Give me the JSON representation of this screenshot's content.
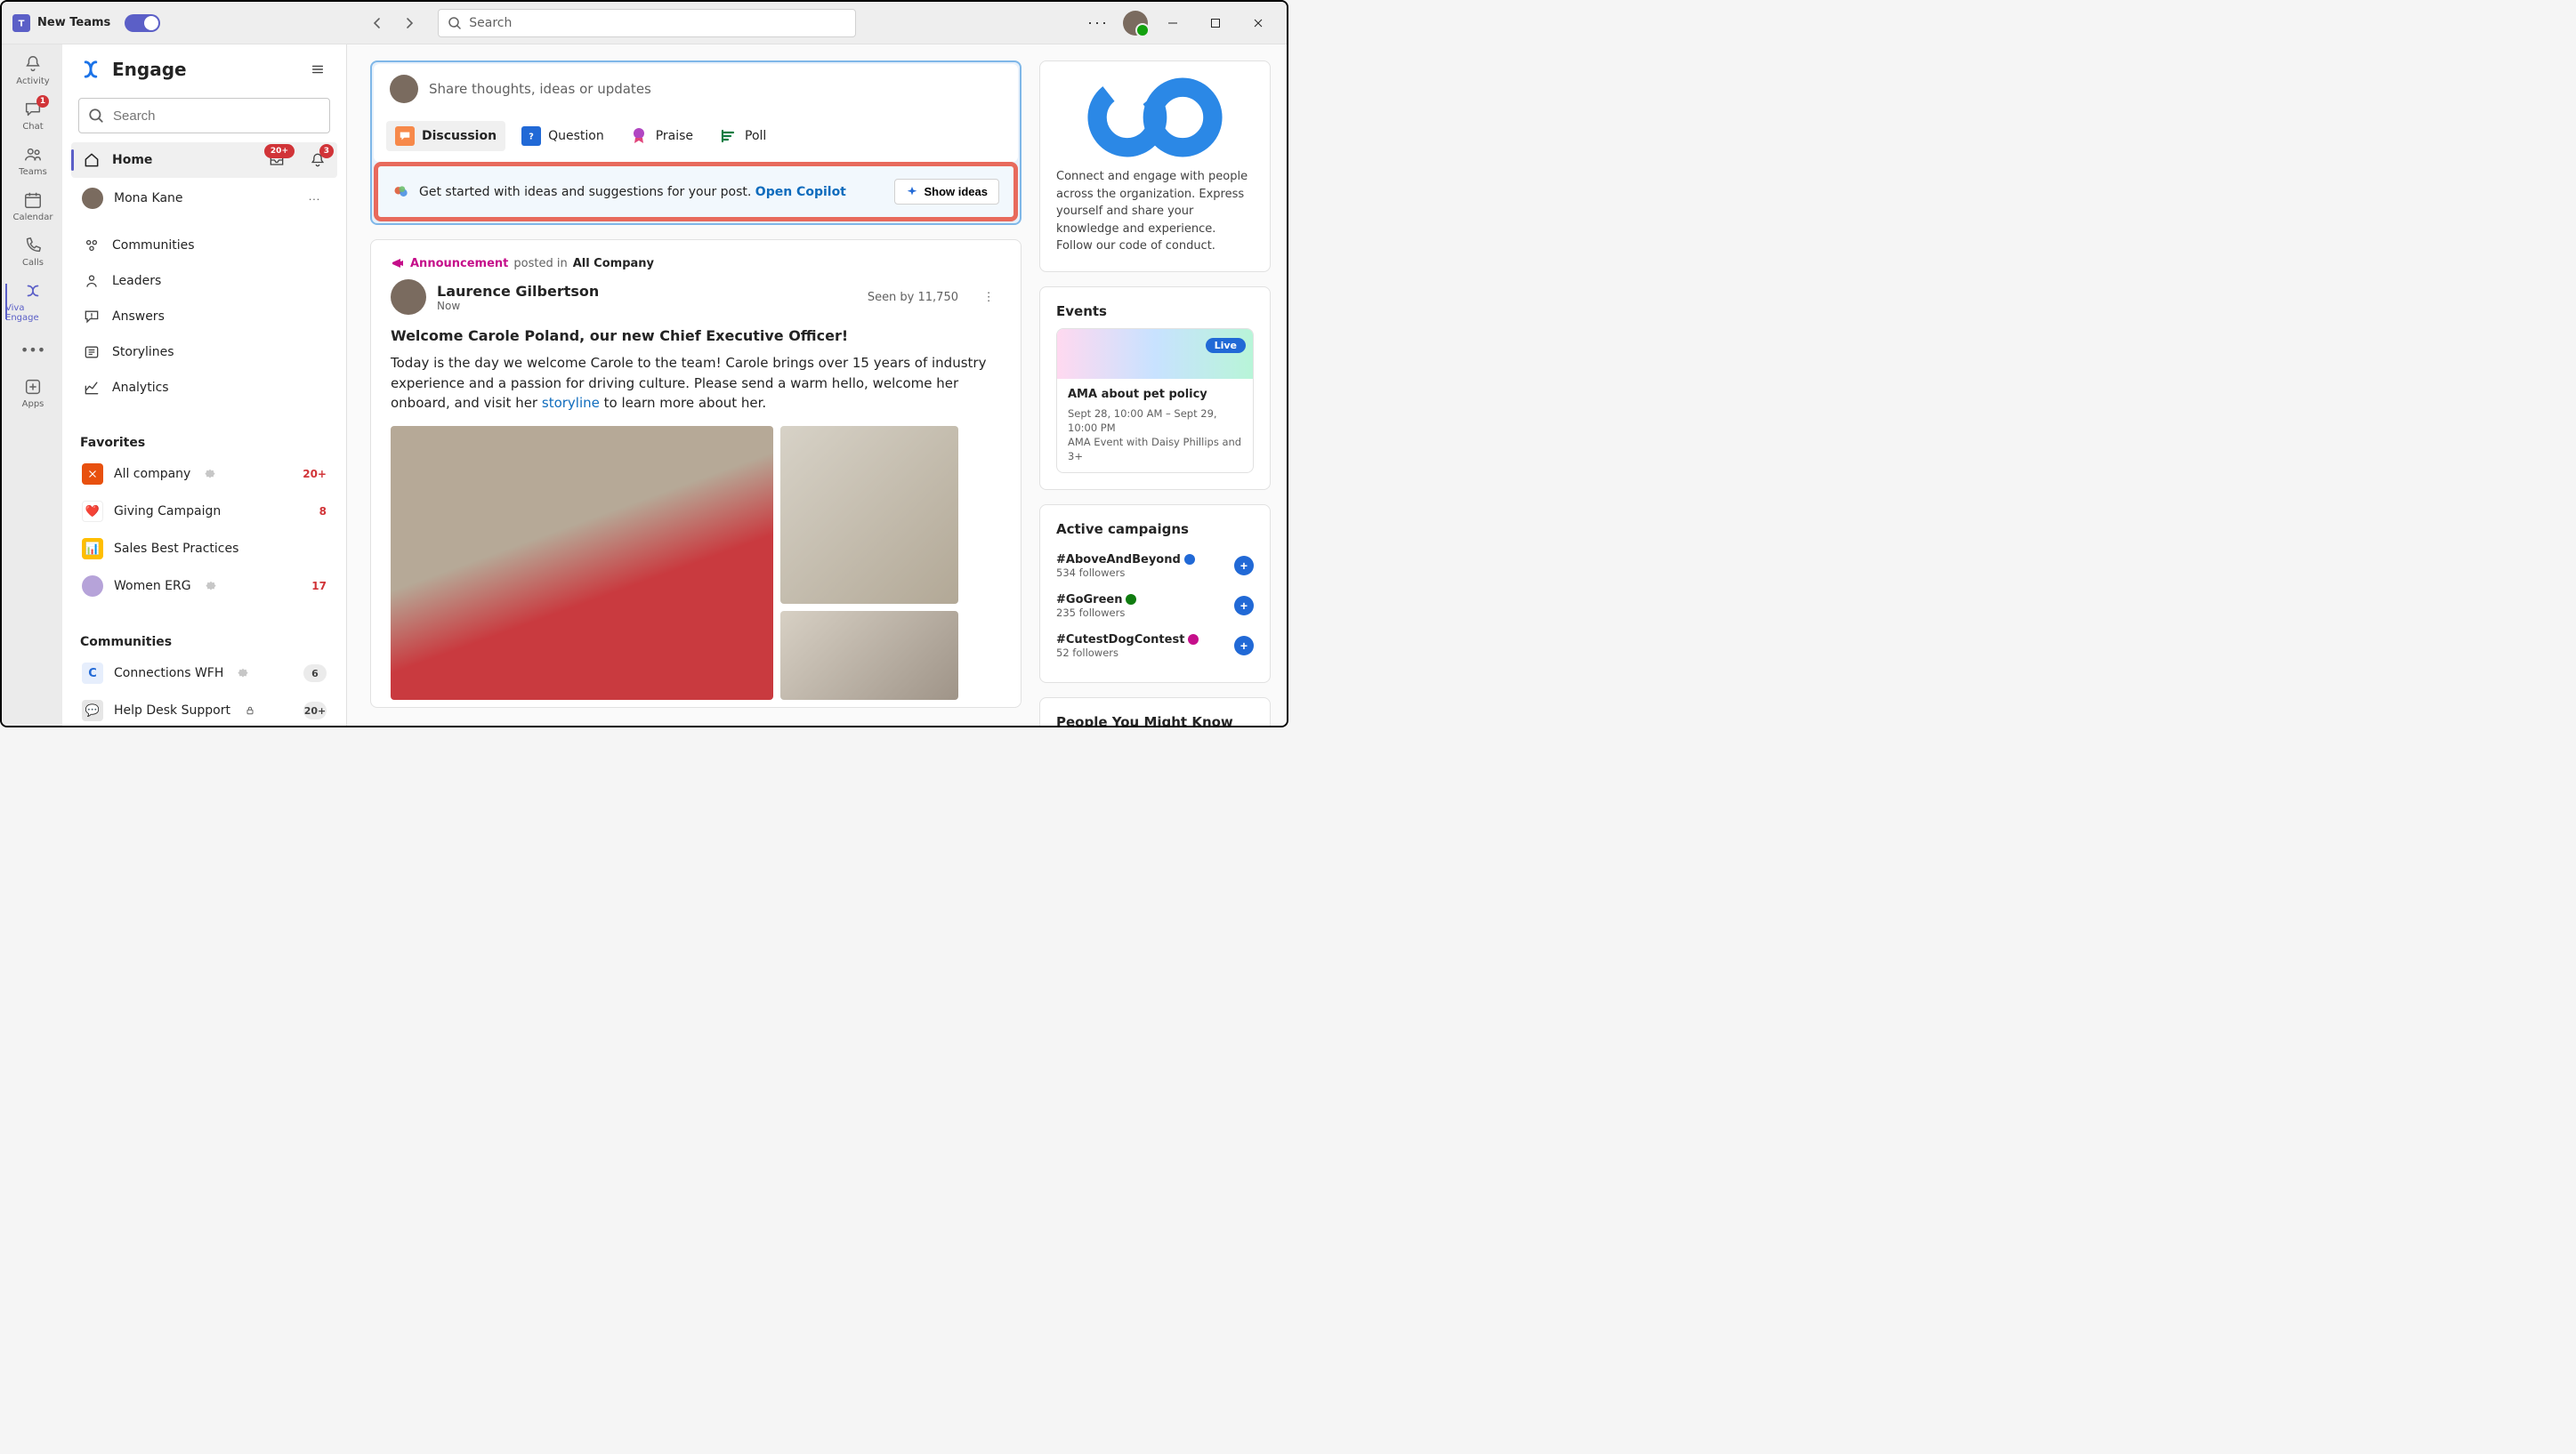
{
  "titlebar": {
    "app_name": "New Teams",
    "search_placeholder": "Search"
  },
  "rail": {
    "items": [
      {
        "id": "activity",
        "label": "Activity"
      },
      {
        "id": "chat",
        "label": "Chat",
        "badge": "1"
      },
      {
        "id": "teams",
        "label": "Teams"
      },
      {
        "id": "calendar",
        "label": "Calendar"
      },
      {
        "id": "calls",
        "label": "Calls"
      },
      {
        "id": "engage",
        "label": "Viva Engage",
        "active": true
      },
      {
        "id": "more",
        "label": ""
      },
      {
        "id": "apps",
        "label": "Apps"
      }
    ]
  },
  "side": {
    "title": "Engage",
    "search_placeholder": "Search",
    "nav": [
      {
        "id": "home",
        "label": "Home",
        "home_badge": "20+",
        "bell_badge": "3",
        "active": true
      },
      {
        "id": "mona",
        "label": "Mona Kane",
        "avatar": true
      },
      {
        "id": "communities",
        "label": "Communities"
      },
      {
        "id": "leaders",
        "label": "Leaders"
      },
      {
        "id": "answers",
        "label": "Answers"
      },
      {
        "id": "storylines",
        "label": "Storylines"
      },
      {
        "id": "analytics",
        "label": "Analytics"
      }
    ],
    "favorites_header": "Favorites",
    "favorites": [
      {
        "label": "All company",
        "count": "20+",
        "color": "#e8500e",
        "verified": true
      },
      {
        "label": "Giving Campaign",
        "count": "8",
        "color": "#ffffff"
      },
      {
        "label": "Sales Best Practices",
        "color": "#ffbf00"
      },
      {
        "label": "Women ERG",
        "count": "17",
        "avatar": true,
        "verified": true
      }
    ],
    "communities_header": "Communities",
    "communities": [
      {
        "label": "Connections WFH",
        "count": "6",
        "color": "#e6eefc",
        "verified": true
      },
      {
        "label": "Help Desk Support",
        "count": "20+",
        "color": "#e6e6e6",
        "locked": true
      }
    ]
  },
  "composer": {
    "placeholder": "Share thoughts, ideas or updates",
    "tabs": [
      {
        "label": "Discussion",
        "active": true,
        "color": "#f7894a"
      },
      {
        "label": "Question",
        "color": "#2169d6"
      },
      {
        "label": "Praise",
        "color": "#b146c2"
      },
      {
        "label": "Poll",
        "color": "#107c41"
      }
    ]
  },
  "copilot": {
    "text": "Get started with ideas and suggestions for your post.",
    "link": "Open Copilot",
    "button": "Show ideas"
  },
  "post": {
    "tag": "Announcement",
    "posted_in": "posted in",
    "target": "All Company",
    "author": "Laurence Gilbertson",
    "time": "Now",
    "seen": "Seen by 11,750",
    "title": "Welcome Carole Poland, our new Chief Executive Officer!",
    "body_before": "Today is the day we welcome Carole to the team! Carole brings over 15 years of industry experience and a passion for driving culture. Please send a warm hello, welcome her onboard, and visit her ",
    "body_link": "storyline",
    "body_after": " to learn more about her."
  },
  "right": {
    "about_text": "Connect and engage with people across the organization. Express yourself and share your knowledge and experience. Follow our code of conduct.",
    "events_header": "Events",
    "event": {
      "live": "Live",
      "title": "AMA about pet policy",
      "when": "Sept 28, 10:00 AM – Sept 29, 10:00 PM",
      "who": "AMA Event with Daisy Phillips and 3+"
    },
    "campaigns_header": "Active campaigns",
    "campaigns": [
      {
        "name": "#AboveAndBeyond",
        "followers": "534 followers",
        "verify": "blue"
      },
      {
        "name": "#GoGreen",
        "followers": "235 followers",
        "verify": "green"
      },
      {
        "name": "#CutestDogContest",
        "followers": "52 followers",
        "verify": "pink"
      }
    ],
    "people_header": "People You Might Know"
  }
}
